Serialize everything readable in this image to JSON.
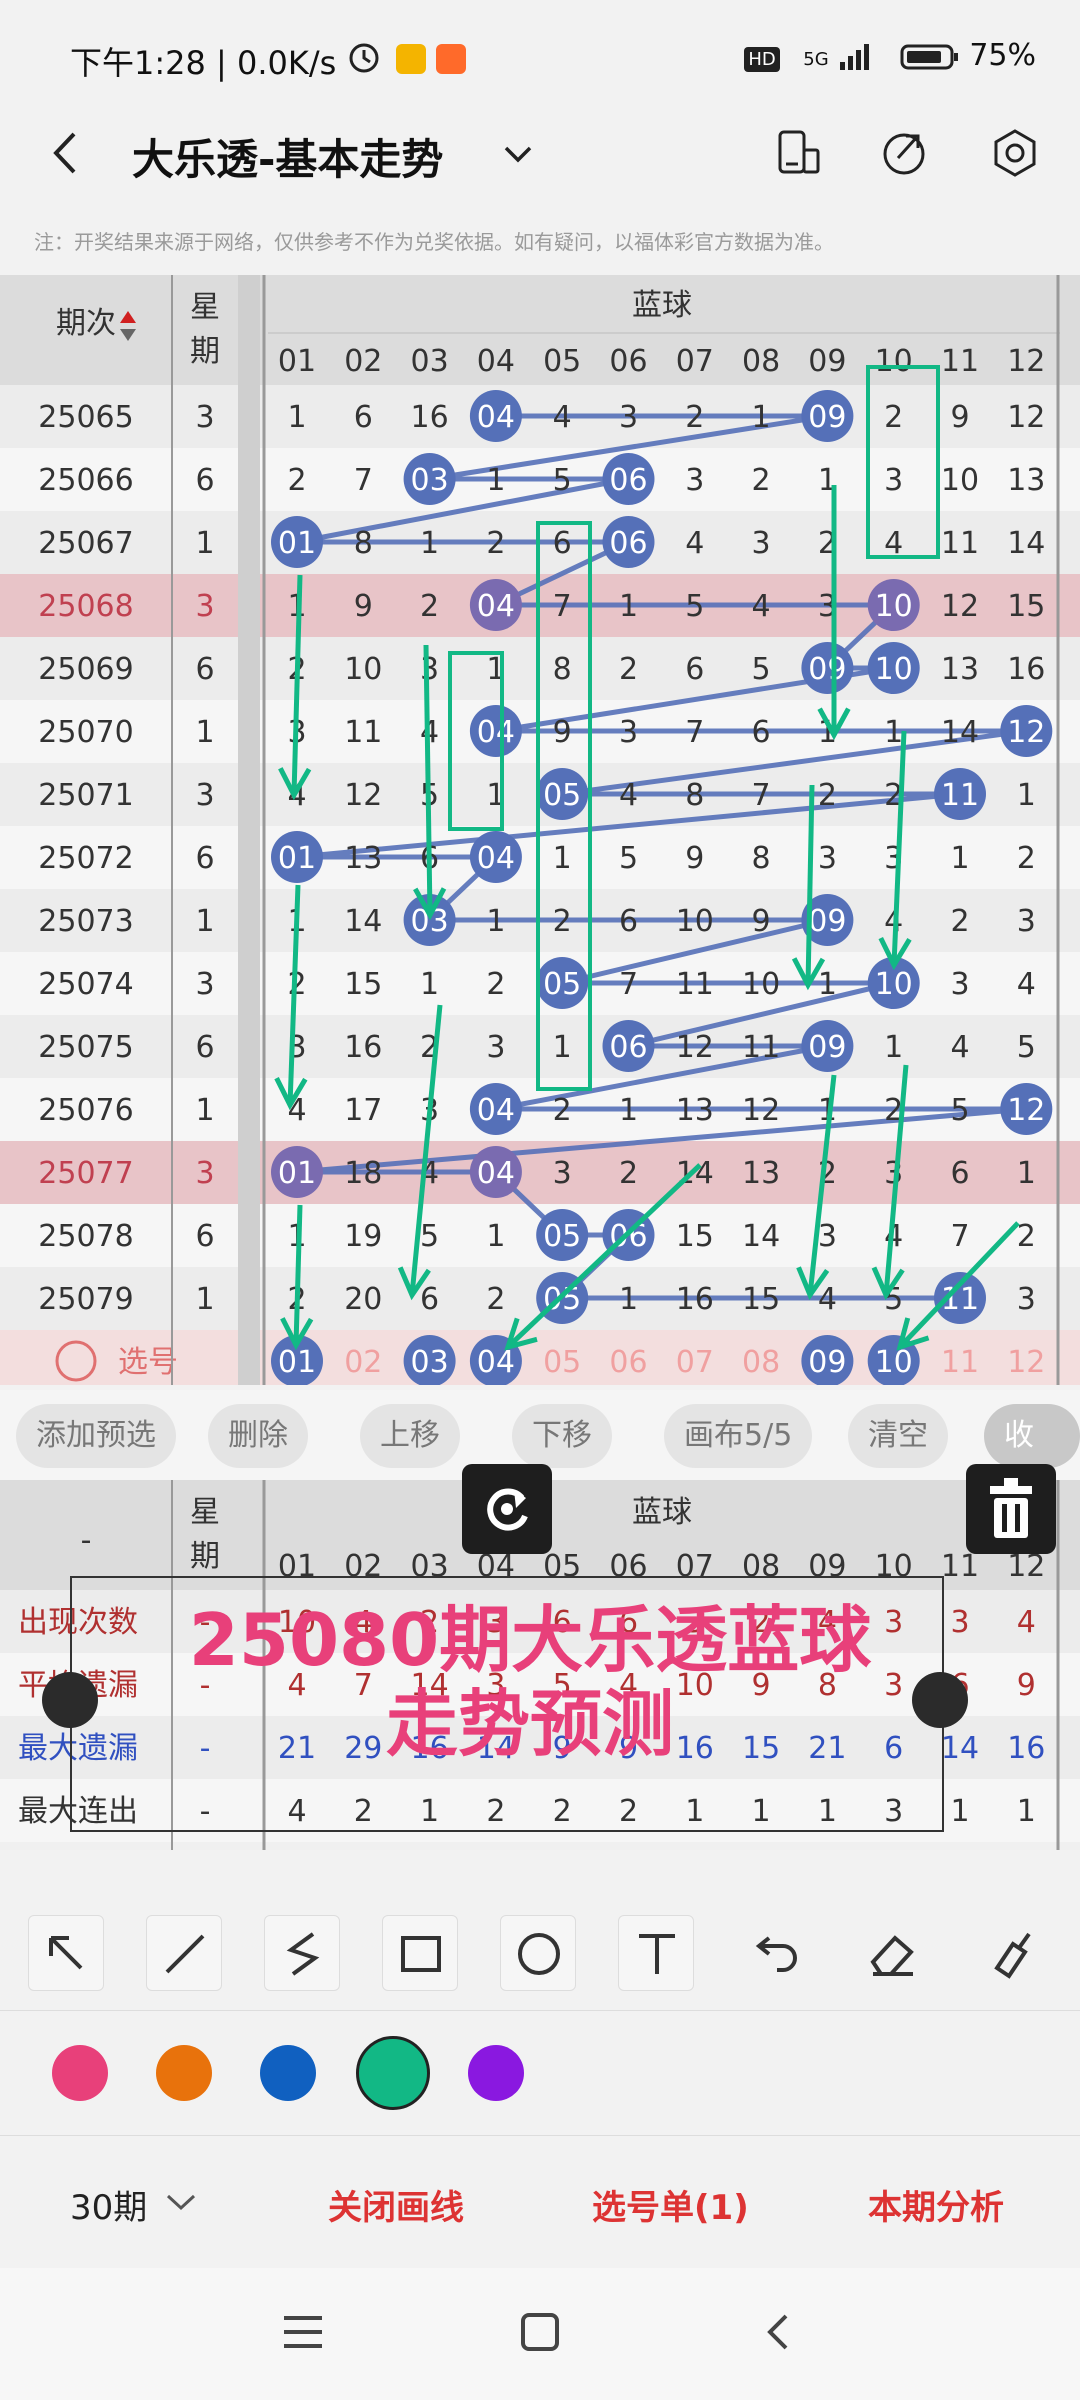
{
  "status": {
    "time": "下午1:28 | 0.0K/s",
    "battery": "75%",
    "network": "5G",
    "hd": "HD"
  },
  "header": {
    "title": "大乐透-基本走势"
  },
  "note": "注：开奖结果来源于网络，仅供参考不作为兑奖依据。如有疑问，以福体彩官方数据为准。",
  "table": {
    "col_period": "期次",
    "col_week": "星期",
    "blue_label": "蓝球",
    "numbers": [
      "01",
      "02",
      "03",
      "04",
      "05",
      "06",
      "07",
      "08",
      "09",
      "10",
      "11",
      "12"
    ],
    "rows": [
      {
        "period": "25065",
        "week": "3",
        "cells": [
          "1",
          "6",
          "16",
          "04",
          "4",
          "3",
          "2",
          "1",
          "09",
          "2",
          "9",
          "12"
        ],
        "hits": [
          3,
          8
        ]
      },
      {
        "period": "25066",
        "week": "6",
        "cells": [
          "2",
          "7",
          "03",
          "1",
          "5",
          "06",
          "3",
          "2",
          "1",
          "3",
          "10",
          "13"
        ],
        "hits": [
          2,
          5
        ]
      },
      {
        "period": "25067",
        "week": "1",
        "cells": [
          "01",
          "8",
          "1",
          "2",
          "6",
          "06",
          "4",
          "3",
          "2",
          "4",
          "11",
          "14"
        ],
        "hits": [
          0,
          5
        ]
      },
      {
        "period": "25068",
        "week": "3",
        "cells": [
          "1",
          "9",
          "2",
          "04",
          "7",
          "1",
          "5",
          "4",
          "3",
          "10",
          "12",
          "15"
        ],
        "hits": [
          3,
          9
        ],
        "pink": true
      },
      {
        "period": "25069",
        "week": "6",
        "cells": [
          "2",
          "10",
          "3",
          "1",
          "8",
          "2",
          "6",
          "5",
          "09",
          "10",
          "13",
          "16"
        ],
        "hits": [
          8,
          9
        ]
      },
      {
        "period": "25070",
        "week": "1",
        "cells": [
          "3",
          "11",
          "4",
          "04",
          "9",
          "3",
          "7",
          "6",
          "1",
          "1",
          "14",
          "12"
        ],
        "hits": [
          3,
          11
        ]
      },
      {
        "period": "25071",
        "week": "3",
        "cells": [
          "4",
          "12",
          "5",
          "1",
          "05",
          "4",
          "8",
          "7",
          "2",
          "2",
          "11",
          "1"
        ],
        "hits": [
          4,
          10
        ]
      },
      {
        "period": "25072",
        "week": "6",
        "cells": [
          "01",
          "13",
          "6",
          "04",
          "1",
          "5",
          "9",
          "8",
          "3",
          "3",
          "1",
          "2"
        ],
        "hits": [
          0,
          3
        ]
      },
      {
        "period": "25073",
        "week": "1",
        "cells": [
          "1",
          "14",
          "03",
          "1",
          "2",
          "6",
          "10",
          "9",
          "09",
          "4",
          "2",
          "3"
        ],
        "hits": [
          2,
          8
        ]
      },
      {
        "period": "25074",
        "week": "3",
        "cells": [
          "2",
          "15",
          "1",
          "2",
          "05",
          "7",
          "11",
          "10",
          "1",
          "10",
          "3",
          "4"
        ],
        "hits": [
          4,
          9
        ]
      },
      {
        "period": "25075",
        "week": "6",
        "cells": [
          "3",
          "16",
          "2",
          "3",
          "1",
          "06",
          "12",
          "11",
          "09",
          "1",
          "4",
          "5"
        ],
        "hits": [
          5,
          8
        ]
      },
      {
        "period": "25076",
        "week": "1",
        "cells": [
          "4",
          "17",
          "3",
          "04",
          "2",
          "1",
          "13",
          "12",
          "1",
          "2",
          "5",
          "12"
        ],
        "hits": [
          3,
          11
        ]
      },
      {
        "period": "25077",
        "week": "3",
        "cells": [
          "01",
          "18",
          "4",
          "04",
          "3",
          "2",
          "14",
          "13",
          "2",
          "3",
          "6",
          "1"
        ],
        "hits": [
          0,
          3
        ],
        "pink": true
      },
      {
        "period": "25078",
        "week": "6",
        "cells": [
          "1",
          "19",
          "5",
          "1",
          "05",
          "06",
          "15",
          "14",
          "3",
          "4",
          "7",
          "2"
        ],
        "hits": [
          4,
          5
        ]
      },
      {
        "period": "25079",
        "week": "1",
        "cells": [
          "2",
          "20",
          "6",
          "2",
          "05",
          "1",
          "16",
          "15",
          "4",
          "5",
          "11",
          "3"
        ],
        "hits": [
          4,
          10
        ]
      }
    ],
    "select_label": "选号",
    "select_row": [
      "01",
      "02",
      "03",
      "04",
      "05",
      "06",
      "07",
      "08",
      "09",
      "10",
      "11",
      "12"
    ],
    "selected": [
      0,
      2,
      3,
      8,
      9
    ]
  },
  "actions": [
    "添加预选",
    "删除",
    "上移",
    "下移",
    "画布5/5",
    "清空",
    "收起"
  ],
  "stats": {
    "header_left": "-",
    "rows": [
      {
        "label": "出现次数",
        "dash": "-",
        "values": [
          "10",
          "4",
          "2",
          "3",
          "6",
          "6",
          "3",
          "2",
          "4",
          "3",
          "3",
          "4"
        ],
        "color": "#b03030"
      },
      {
        "label": "平均遗漏",
        "dash": "-",
        "values": [
          "4",
          "7",
          "14",
          "3",
          "5",
          "4",
          "10",
          "9",
          "8",
          "3",
          "6",
          "9"
        ],
        "color": "#b03030"
      },
      {
        "label": "最大遗漏",
        "dash": "-",
        "values": [
          "21",
          "29",
          "16",
          "14",
          "9",
          "9",
          "16",
          "15",
          "21",
          "6",
          "14",
          "16"
        ],
        "color": "#3050c0"
      },
      {
        "label": "最大连出",
        "dash": "-",
        "values": [
          "4",
          "2",
          "1",
          "2",
          "2",
          "2",
          "1",
          "1",
          "1",
          "3",
          "1",
          "1"
        ],
        "color": "#333333"
      }
    ]
  },
  "overlay": {
    "line1": "25080期大乐透蓝球",
    "line2": "走势预测"
  },
  "draw_colors": [
    "#e8407a",
    "#e8720c",
    "#1060c0",
    "#12b885",
    "#8a18e0"
  ],
  "bottom": {
    "periods": "30期",
    "close_lines": "关闭画线",
    "select_list": "选号单(1)",
    "analysis": "本期分析"
  }
}
